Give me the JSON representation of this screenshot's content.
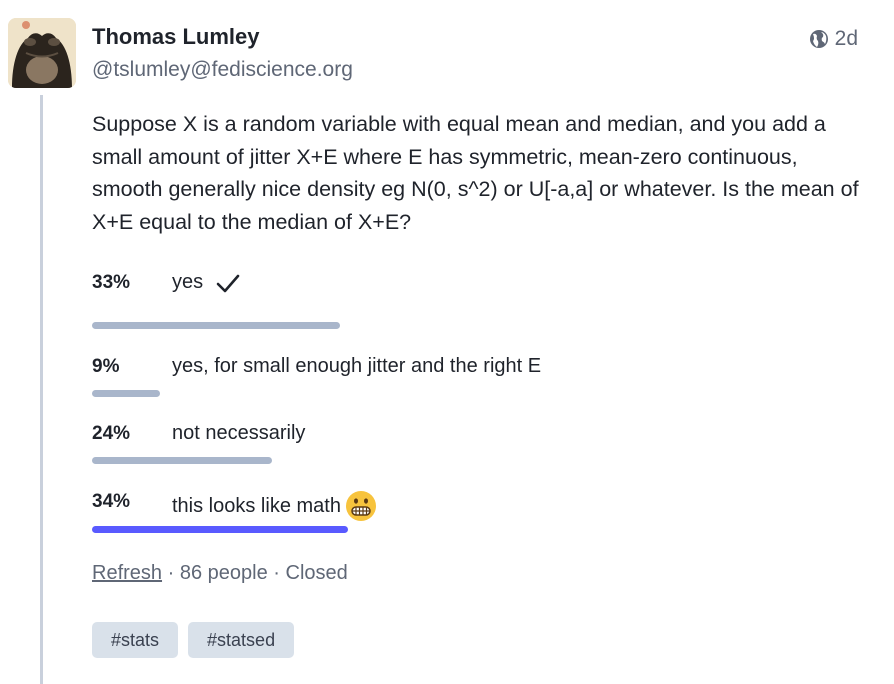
{
  "post": {
    "author_name": "Thomas Lumley",
    "author_handle": "@tslumley@fediscience.org",
    "time": "2d",
    "visibility_icon": "globe-icon",
    "content": "Suppose X is a random variable with equal mean and median, and you add a small amount of jitter X+E where E has symmetric, mean-zero continuous, smooth generally nice density eg N(0, s^2) or U[-a,a] or whatever. Is the mean of X+E equal to the median of X+E?"
  },
  "poll": {
    "options": [
      {
        "percent": "33%",
        "label": "yes",
        "voted": true,
        "share": 0.33
      },
      {
        "percent": "9%",
        "label": "yes, for small enough jitter and the right E",
        "voted": false,
        "share": 0.09
      },
      {
        "percent": "24%",
        "label": "not necessarily",
        "voted": false,
        "share": 0.24
      },
      {
        "percent": "34%",
        "label": "this looks like math",
        "voted": false,
        "share": 0.34,
        "emoji": "grimacing-face-emoji",
        "leading": true
      }
    ],
    "refresh_label": "Refresh",
    "separator": "·",
    "people": "86 people",
    "status": "Closed"
  },
  "tags": [
    "#stats",
    "#statsed"
  ],
  "colors": {
    "accent": "#595aff",
    "bar": "#a9b6cb",
    "tag_bg": "#d9e1ea",
    "thread_line": "#c9d0dc"
  }
}
